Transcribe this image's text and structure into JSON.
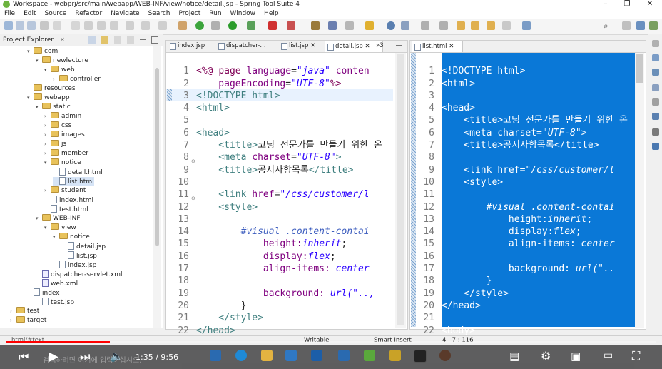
{
  "window": {
    "title": "Workspace - webprj/src/main/webapp/WEB-INF/view/notice/detail.jsp - Spring Tool Suite 4",
    "controls": [
      "–",
      "❐",
      "✕"
    ]
  },
  "menu": [
    "File",
    "Edit",
    "Source",
    "Refactor",
    "Navigate",
    "Search",
    "Project",
    "Run",
    "Window",
    "Help"
  ],
  "explorer": {
    "title": "Project Explorer",
    "close": "✕",
    "items": [
      {
        "label": "com",
        "icon": "folder",
        "arrow": "▾"
      },
      {
        "label": "newlecture",
        "icon": "folder",
        "arrow": "▾"
      },
      {
        "label": "web",
        "icon": "folder",
        "arrow": "▾"
      },
      {
        "label": "controller",
        "icon": "folder",
        "arrow": "›"
      },
      {
        "label": "resources",
        "icon": "folder",
        "arrow": ""
      },
      {
        "label": "webapp",
        "icon": "folder",
        "arrow": "▾"
      },
      {
        "label": "static",
        "icon": "folder",
        "arrow": "▾"
      },
      {
        "label": "admin",
        "icon": "folder",
        "arrow": "›"
      },
      {
        "label": "css",
        "icon": "folder",
        "arrow": "›"
      },
      {
        "label": "images",
        "icon": "folder",
        "arrow": "›"
      },
      {
        "label": "js",
        "icon": "folder",
        "arrow": "›"
      },
      {
        "label": "member",
        "icon": "folder",
        "arrow": "›"
      },
      {
        "label": "notice",
        "icon": "folder",
        "arrow": "▾"
      },
      {
        "label": "detail.html",
        "icon": "file",
        "arrow": ""
      },
      {
        "label": "list.html",
        "icon": "file",
        "arrow": ""
      },
      {
        "label": "student",
        "icon": "folder",
        "arrow": "›"
      },
      {
        "label": "index.html",
        "icon": "file",
        "arrow": ""
      },
      {
        "label": "test.html",
        "icon": "file",
        "arrow": ""
      },
      {
        "label": "WEB-INF",
        "icon": "folder",
        "arrow": "▾"
      },
      {
        "label": "view",
        "icon": "folder",
        "arrow": "▾"
      },
      {
        "label": "notice",
        "icon": "folder",
        "arrow": "▾"
      },
      {
        "label": "detail.jsp",
        "icon": "file",
        "arrow": ""
      },
      {
        "label": "list.jsp",
        "icon": "file",
        "arrow": ""
      },
      {
        "label": "index.jsp",
        "icon": "file",
        "arrow": ""
      },
      {
        "label": "dispatcher-servlet.xml",
        "icon": "xml",
        "arrow": ""
      },
      {
        "label": "web.xml",
        "icon": "xml",
        "arrow": ""
      },
      {
        "label": "index",
        "icon": "file",
        "arrow": ""
      },
      {
        "label": "test.jsp",
        "icon": "file",
        "arrow": ""
      },
      {
        "label": "test",
        "icon": "folder",
        "arrow": "›"
      },
      {
        "label": "target",
        "icon": "folder",
        "arrow": "›"
      }
    ]
  },
  "left_editor": {
    "tabs": [
      "index.jsp",
      "dispatcher-...",
      "list.jsp",
      "detail.jsp",
      "»3"
    ],
    "active_tab": "detail.jsp",
    "lines": [
      "1",
      "2",
      "3",
      "4",
      "5",
      "6",
      "7",
      "8",
      "9",
      "10",
      "11",
      "12",
      "13",
      "14",
      "15",
      "16",
      "17",
      "18",
      "19",
      "20",
      "21",
      "22"
    ]
  },
  "right_editor": {
    "tab": "list.html",
    "lines": [
      "1",
      "2",
      "3",
      "4",
      "5",
      "6",
      "7",
      "8",
      "9",
      "10",
      "11",
      "12",
      "13",
      "14",
      "15",
      "16",
      "17",
      "18",
      "19",
      "20",
      "21",
      "22"
    ]
  },
  "code": {
    "l1a": "<%@ ",
    "l1b": "page ",
    "l1c": "language",
    "l1d": "=",
    "l1e": "\"java\"",
    "l1f": " conten",
    "l2a": "    pageEncoding",
    "l2b": "=",
    "l2c": "\"UTF-8\"",
    "l2d": "%>",
    "l3": "<!DOCTYPE html>",
    "l4": "<html>",
    "l6": "<head>",
    "l7a": "    <title>",
    "l7b": "코딩 전문가를 만들기 위한 온",
    "l7c": "",
    "l8a": "    <meta ",
    "l8b": "charset",
    "l8c": "=",
    "l8d": "\"UTF-8\"",
    "l8e": ">",
    "l9a": "    <title>",
    "l9b": "공지사항목록",
    "l9c": "</title>",
    "l11a": "    <link ",
    "l11b": "href",
    "l11c": "=",
    "l11d": "\"/css/customer/l",
    "l12": "    <style>",
    "l14": "        #visual .content-contai",
    "l15a": "            height:",
    "l15b": "inherit",
    "l15c": ";",
    "l16a": "            display:",
    "l16b": "flex",
    "l16c": ";",
    "l17a": "            align-items: ",
    "l17b": "center",
    "l19a": "            background: ",
    "l19b": "url(\"..,",
    "l20": "        }",
    "l21": "    </style>",
    "l22": "</head>"
  },
  "rcode": {
    "l1": "<!DOCTYPE html>",
    "l2": "<html>",
    "l4": "<head>",
    "l5": "    <title>코딩 전문가를 만들기 위한 온",
    "l6a": "    <meta charset=",
    "l6b": "\"UTF-8\"",
    "l6c": ">",
    "l7": "    <title>공지사항목록</title>",
    "l9a": "    <link href=",
    "l9b": "\"/css/customer/l",
    "l10": "    <style>",
    "l12": "        #visual .content-contai",
    "l13a": "            height:",
    "l13b": "inherit",
    "l13c": ";",
    "l14a": "            display:",
    "l14b": "flex",
    "l14c": ";",
    "l15a": "            align-items: ",
    "l15b": "center",
    "l17a": "            background: ",
    "l17b": "url(\"..",
    "l18": "        }",
    "l19": "    </style>",
    "l20": "</head>",
    "l22": "<body>"
  },
  "status": {
    "left": "html/#text",
    "writable": "Writable",
    "insert": "Smart Insert",
    "position": "4 : 7 : 116"
  },
  "player": {
    "time": "1:35 / 9:56",
    "progress": 0.16,
    "subtitle": "검색하려면 여기에 입력하십시오."
  },
  "colors": {
    "selection_blue": "#0a78d7",
    "tag": "#3f7f7f",
    "keyword": "#7f0055",
    "string": "#2a00ff",
    "progress_red": "#ff0000"
  }
}
